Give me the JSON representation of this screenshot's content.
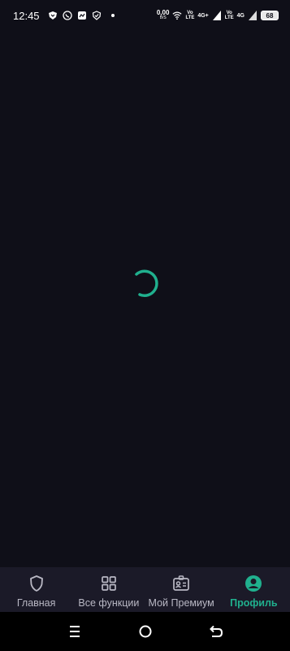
{
  "status_bar": {
    "time": "12:45",
    "speed_value": "0,00",
    "speed_unit": "B/S",
    "sim1_label_top": "Vo",
    "sim1_label_bottom": "LTE",
    "sim1_network": "4G+",
    "sim2_label_top": "Vo",
    "sim2_label_bottom": "LTE",
    "sim2_network": "4G",
    "battery": "68"
  },
  "loading": {
    "accent_color": "#20b08e"
  },
  "bottom_nav": {
    "items": [
      {
        "label": "Главная",
        "icon": "shield-icon",
        "active": false
      },
      {
        "label": "Все функции",
        "icon": "grid-icon",
        "active": false
      },
      {
        "label": "Мой Премиум",
        "icon": "id-card-icon",
        "active": false
      },
      {
        "label": "Профиль",
        "icon": "profile-icon",
        "active": true
      }
    ]
  },
  "colors": {
    "background": "#0f0f18",
    "nav_background": "#1b1a28",
    "accent": "#20b08e",
    "inactive": "#b9b8c4"
  }
}
